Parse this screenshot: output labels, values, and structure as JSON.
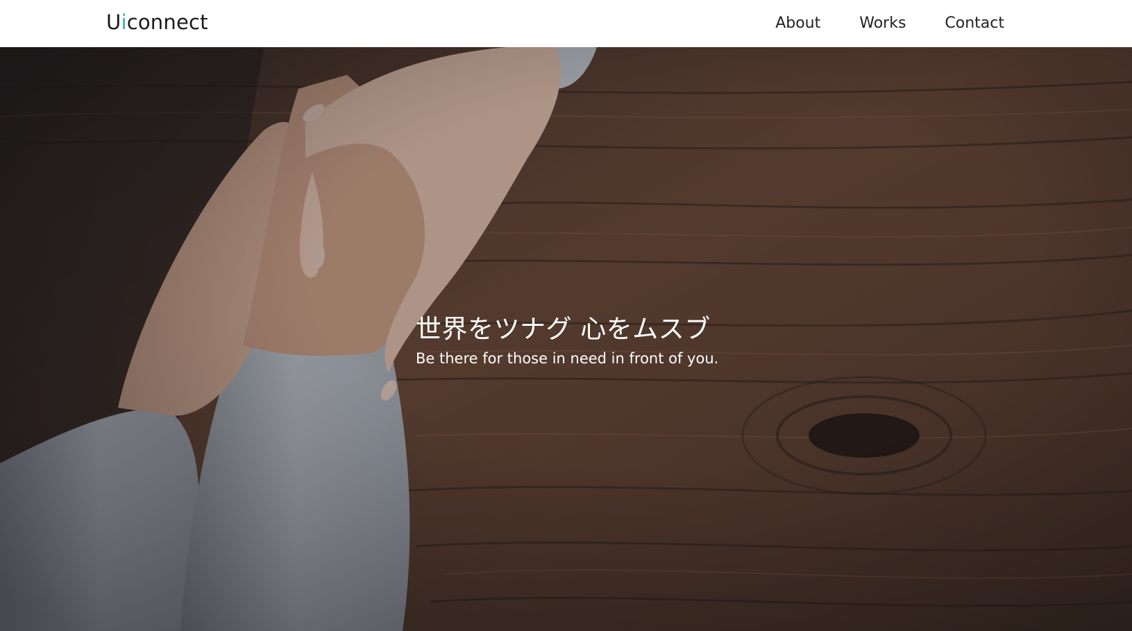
{
  "header": {
    "logo": {
      "prefix": "U",
      "accent": "i",
      "suffix": "connect"
    },
    "nav": [
      {
        "label": "About"
      },
      {
        "label": "Works"
      },
      {
        "label": "Contact"
      }
    ]
  },
  "hero": {
    "background_image": "photo of two people holding hands on a dark wooden table",
    "title": "世界をツナグ 心をムスブ",
    "subtitle": "Be there for those in need in front of you."
  },
  "colors": {
    "header_bg": "#ffffff",
    "logo_accent": "#2bb3a8",
    "nav_text": "#222222",
    "hero_text": "#ffffff",
    "wood": "#5a3b28",
    "sweater": "#b7bcc2",
    "skin": "#d9ab8e"
  }
}
